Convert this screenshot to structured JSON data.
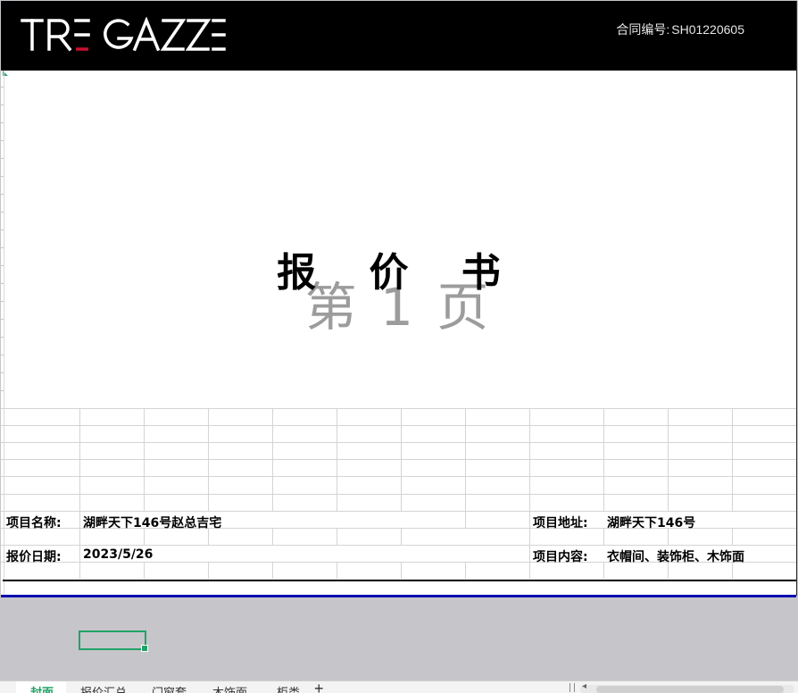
{
  "header": {
    "logo_text": "TRE GAZZE",
    "contract_label": "合同编号:",
    "contract_number": "SH01220605"
  },
  "document": {
    "title": "报 价 书",
    "page_watermark": "第 1 页"
  },
  "fields": {
    "project_name_label": "项目名称:",
    "project_name_value": "湖畔天下146号赵总吉宅",
    "project_address_label": "项目地址:",
    "project_address_value": "湖畔天下146号",
    "quote_date_label": "报价日期:",
    "quote_date_value": "2023/5/26",
    "project_content_label": "项目内容:",
    "project_content_value": "衣帽间、装饰柜、木饰面"
  },
  "sheet_tabs": [
    {
      "label": "封面",
      "active": true
    },
    {
      "label": "报价汇总",
      "active": false
    },
    {
      "label": "门窗套",
      "active": false
    },
    {
      "label": "木饰面",
      "active": false
    },
    {
      "label": "柜类",
      "active": false
    }
  ],
  "colors": {
    "header_bg": "#000000",
    "logo_red": "#c8102e",
    "selection": "#21a366",
    "print_border": "#0a0ab0",
    "workspace_bg": "#c6c5ca"
  },
  "icons": {
    "add_sheet": "plus-icon"
  }
}
